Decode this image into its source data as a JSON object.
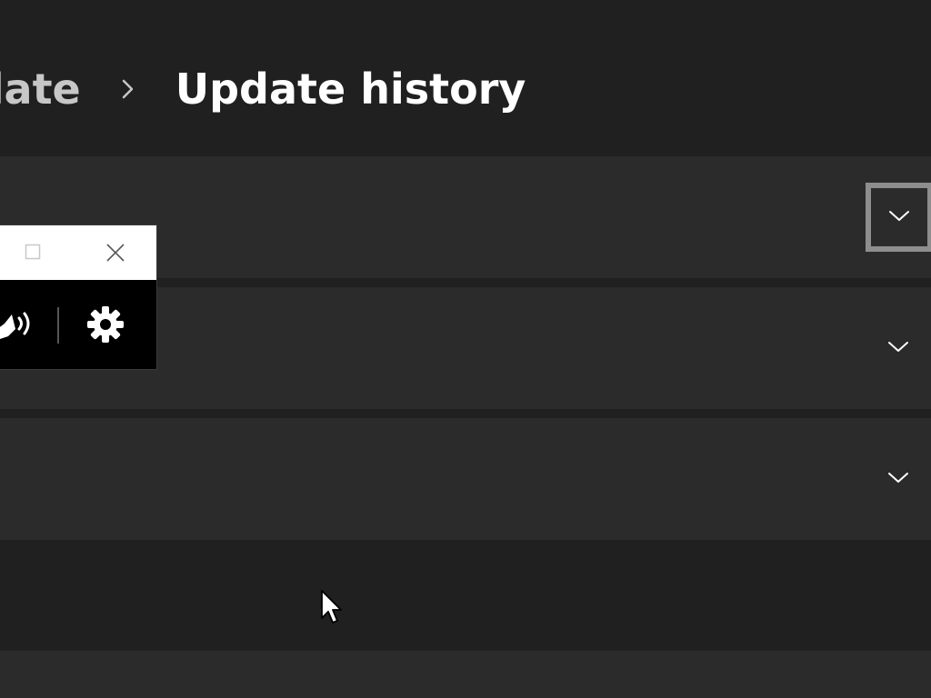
{
  "breadcrumb": {
    "parent": "odate",
    "current": "Update history"
  },
  "icons": {
    "separator": "chevron-right-icon",
    "expand": "chevron-down-icon",
    "maximize": "maximize-icon",
    "close": "close-icon",
    "speaker": "speaker-icon",
    "settings": "gear-icon",
    "cursor": "mouse-pointer-icon"
  },
  "cards": [
    {
      "id": "card-1",
      "focused": true
    },
    {
      "id": "card-2",
      "focused": false
    },
    {
      "id": "card-3",
      "focused": false
    }
  ],
  "colors": {
    "background": "#202020",
    "card": "#2b2b2b",
    "focus_ring": "#8e8e8e",
    "parent_text": "#c7c7c7",
    "title_text": "#ffffff"
  }
}
